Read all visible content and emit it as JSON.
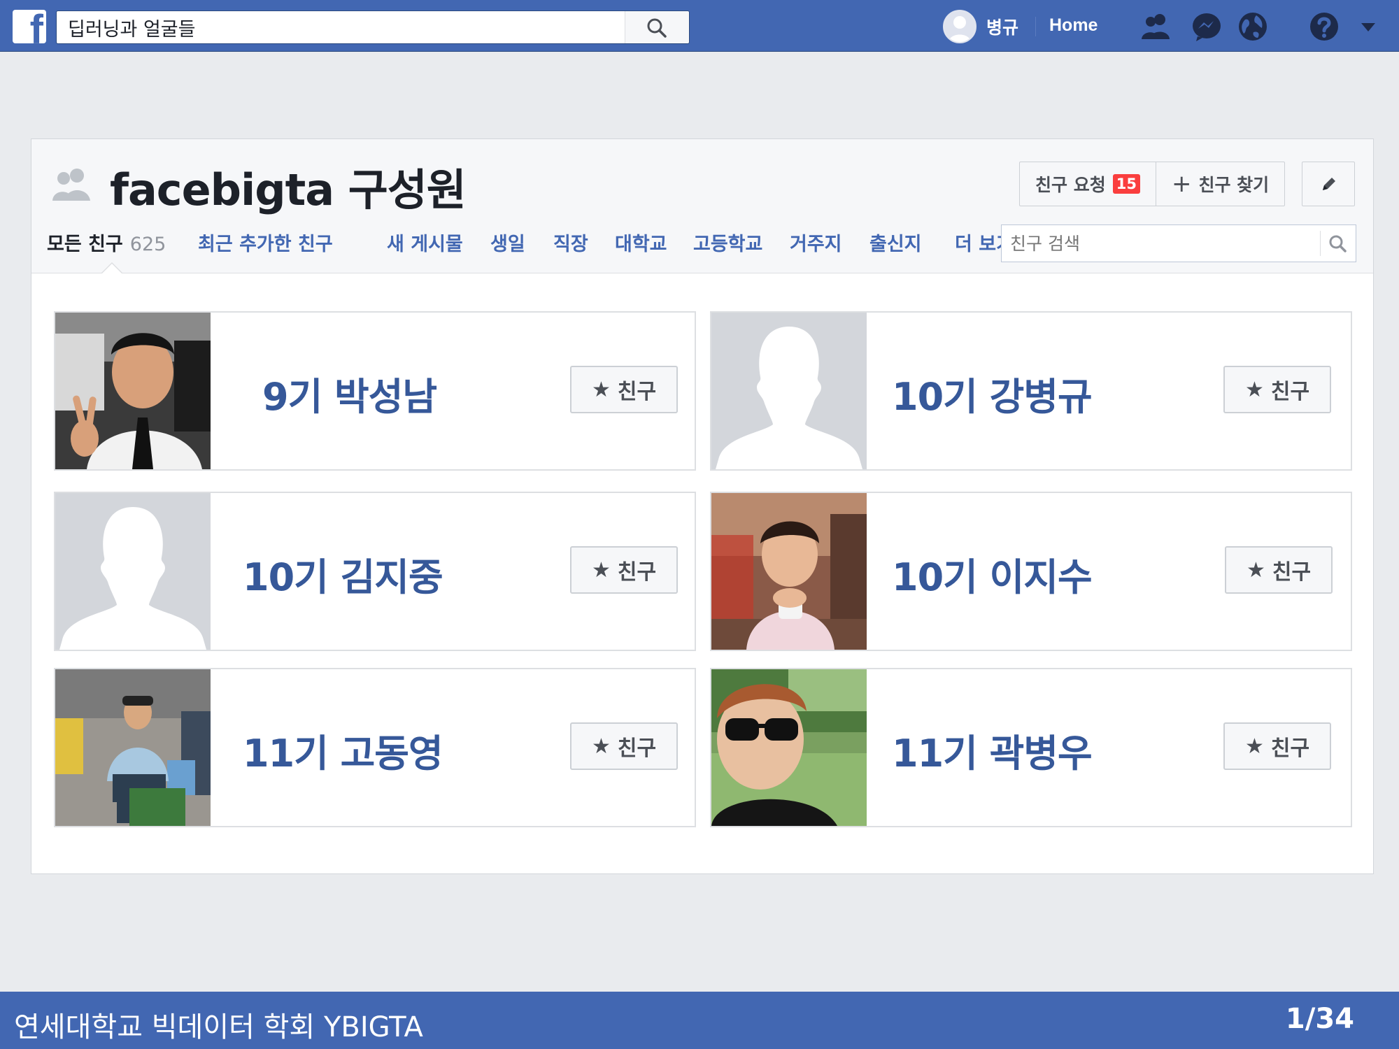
{
  "topbar": {
    "logo": "f",
    "search_value": "딥러닝과 얼굴들",
    "user_name": "병규",
    "home_label": "Home",
    "icons": [
      "friends-icon",
      "messenger-icon",
      "globe-icon",
      "help-icon",
      "caret-down-icon"
    ]
  },
  "group": {
    "title": "facebigta 구성원",
    "friend_requests_label": "친구 요청",
    "friend_requests_count": "15",
    "find_friends_label": "친구 찾기",
    "tabs": [
      {
        "label": "모든 친구",
        "count": "625"
      },
      {
        "label": "최근 추가한 친구"
      },
      {
        "label": "새 게시물"
      },
      {
        "label": "생일"
      },
      {
        "label": "직장"
      },
      {
        "label": "대학교"
      },
      {
        "label": "고등학교"
      },
      {
        "label": "거주지"
      },
      {
        "label": "출신지"
      },
      {
        "label": "더 보기"
      }
    ],
    "search_placeholder": "친구 검색"
  },
  "friends": [
    {
      "name": "9기 박성남",
      "button": "친구",
      "photo": "photo"
    },
    {
      "name": "10기 강병규",
      "button": "친구",
      "photo": "silhouette"
    },
    {
      "name": "10기 김지중",
      "button": "친구",
      "photo": "silhouette"
    },
    {
      "name": "10기 이지수",
      "button": "친구",
      "photo": "photo"
    },
    {
      "name": "11기 고동영",
      "button": "친구",
      "photo": "photo"
    },
    {
      "name": "11기 곽병우",
      "button": "친구",
      "photo": "photo"
    }
  ],
  "footer": {
    "text": "연세대학교 빅데이터 학회 YBIGTA",
    "page": "1/34"
  },
  "colors": {
    "brand": "#4267b2",
    "link": "#365899",
    "badge": "#fa3e3e"
  }
}
